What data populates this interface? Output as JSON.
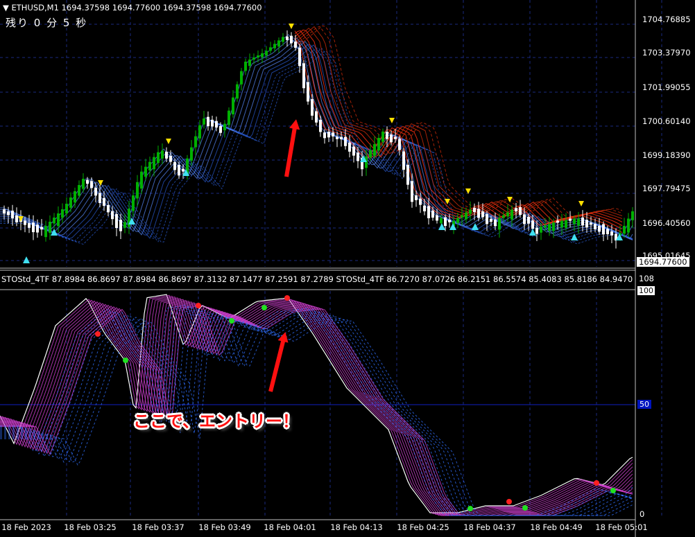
{
  "header": {
    "symbol": "ETHUSD,M1",
    "ohlc": "1694.37598 1694.77600 1694.37598 1694.77600",
    "timer": "残り 0 分 5 秒"
  },
  "price_axis": {
    "ticks": [
      "1704.76885",
      "1703.37970",
      "1701.99055",
      "1700.60140",
      "1699.18390",
      "1697.79475",
      "1696.40560",
      "1695.01645"
    ],
    "current": "1694.77600"
  },
  "indicator": {
    "legend": "STOStd_4TF 87.8984 86.8697 87.8984 86.8697 87.3132 87.1477 87.2591 87.2789 STOStd_4TF 86.7270 87.0726 86.2151 86.5574 85.4083 85.8186 84.9470 85",
    "ticks": {
      "top": "108",
      "max": "100",
      "mid": "50",
      "zero": "0"
    }
  },
  "time_axis": [
    "18 Feb 2023",
    "18 Feb 03:25",
    "18 Feb 03:37",
    "18 Feb 03:49",
    "18 Feb 04:01",
    "18 Feb 04:13",
    "18 Feb 04:25",
    "18 Feb 04:37",
    "18 Feb 04:49",
    "18 Feb 05:01"
  ],
  "annotation": "ここで、エントリー！",
  "colors": {
    "bull": "#00b000",
    "bear": "#ffffff",
    "ribbon_up": "#3080ff",
    "ribbon_down": "#ff3010",
    "stoch": "#d040d0",
    "arrow": "#ff1010",
    "grid": "#1a2a80"
  }
}
